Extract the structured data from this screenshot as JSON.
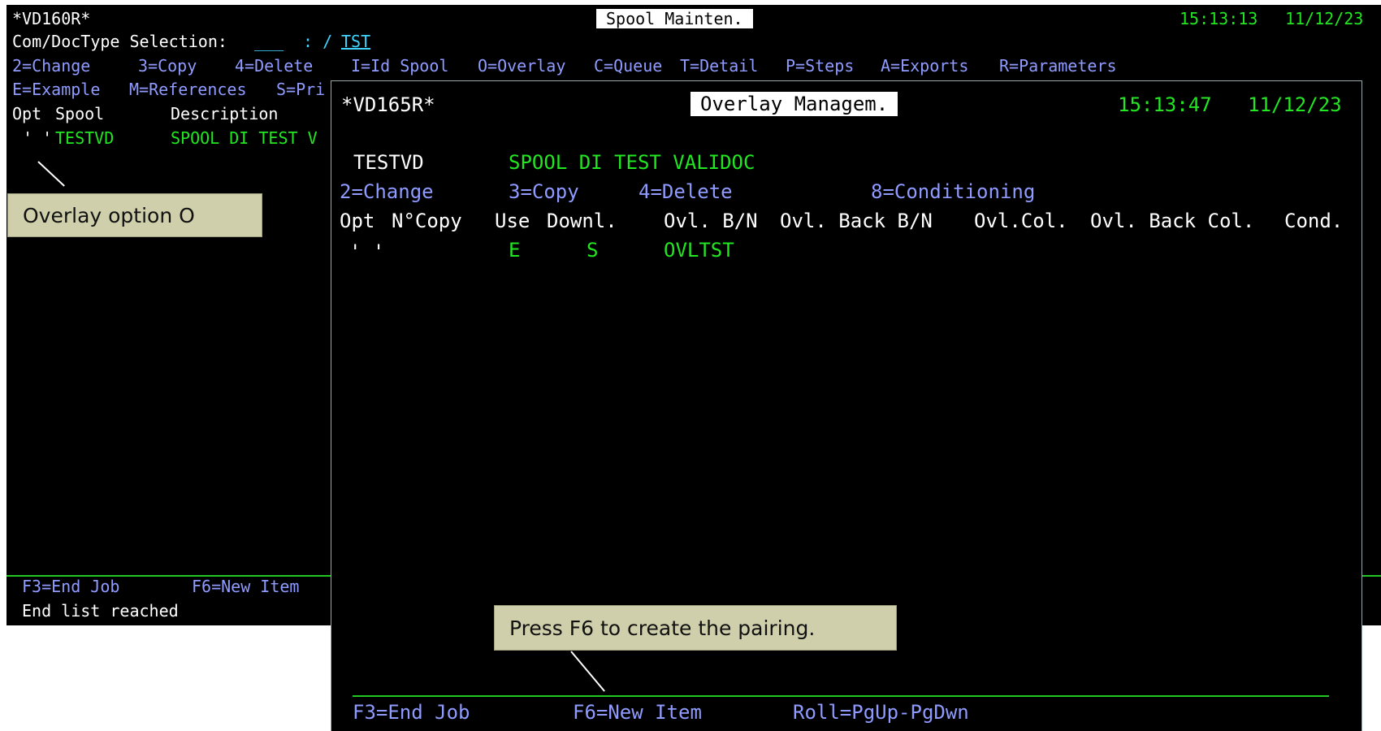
{
  "back_screen": {
    "program": "*VD160R*",
    "title": "Spool Mainten.",
    "time": "15:13:13",
    "date": "11/12/23",
    "selection_label": "Com/DocType Selection:",
    "selection_field": "___",
    "selection_sep": ": /",
    "doctype_value": "TST",
    "options_line1": [
      "2=Change",
      "3=Copy",
      "4=Delete",
      "I=Id Spool",
      "O=Overlay",
      "C=Queue",
      "T=Detail",
      "P=Steps",
      "A=Exports",
      "R=Parameters"
    ],
    "options_line2": [
      "E=Example",
      "M=References",
      "S=Pri"
    ],
    "headers": {
      "opt": "Opt",
      "spool": "Spool",
      "description": "Description"
    },
    "row": {
      "opt": "' '",
      "spool": "TESTVD",
      "description": "SPOOL DI TEST V"
    },
    "fkeys": {
      "f3": "F3=End Job",
      "f6": "F6=New Item"
    },
    "message": "End list reached"
  },
  "front_screen": {
    "program": "*VD165R*",
    "title": "Overlay Managem.",
    "time": "15:13:47",
    "date": "11/12/23",
    "spool_name": "TESTVD",
    "spool_description": "SPOOL DI TEST VALIDOC",
    "options": [
      "2=Change",
      "3=Copy",
      "4=Delete",
      "8=Conditioning"
    ],
    "headers": {
      "opt": "Opt",
      "ncopy": "N°Copy",
      "use": "Use",
      "downl": "Downl.",
      "ovl_bn": "Ovl. B/N",
      "ovl_back_bn": "Ovl. Back B/N",
      "ovl_col": "Ovl.Col.",
      "ovl_back_col": "Ovl. Back Col.",
      "cond": "Cond."
    },
    "row": {
      "opt": "' '",
      "use": "E",
      "downl": "S",
      "overlay": "OVLTST"
    },
    "fkeys": {
      "f3": "F3=End Job",
      "f6": "F6=New Item",
      "roll": "Roll=PgUp-PgDwn"
    }
  },
  "callouts": {
    "overlay_option": "Overlay option O",
    "press_f6": "Press F6 to create the pairing."
  },
  "colors": {
    "background": "#000000",
    "text_white": "#ffffff",
    "text_green": "#22e622",
    "text_blue": "#8f9bff",
    "callout_bg": "#cfcfab"
  }
}
